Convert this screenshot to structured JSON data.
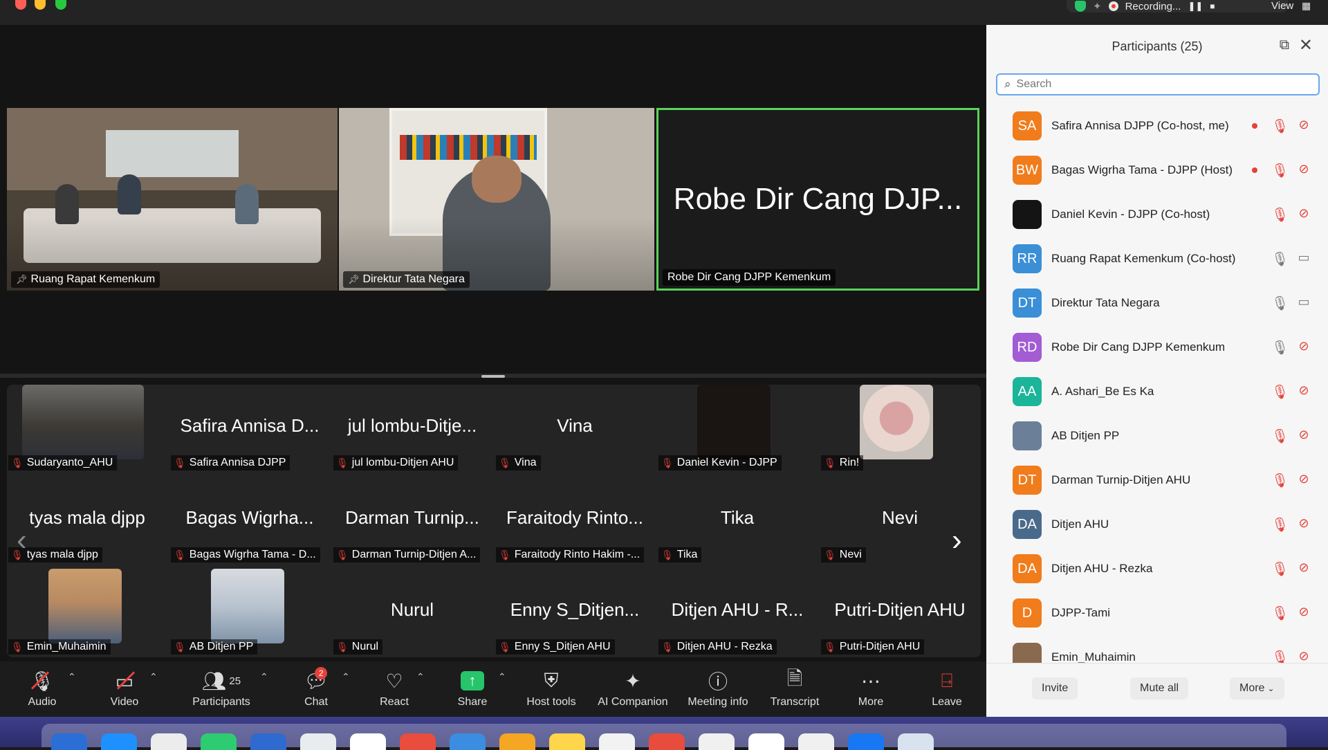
{
  "titlebar": {
    "recording_label": "Recording...",
    "view_label": "View"
  },
  "stage": {
    "top_tiles": [
      {
        "label": "Ruang Rapat Kemenkum"
      },
      {
        "label": "Direktur Tata Negara"
      },
      {
        "big_name": "Robe Dir Cang DJP...",
        "label": "Robe Dir Cang DJPP Kemenkum"
      }
    ]
  },
  "gallery": [
    {
      "big": "",
      "label": "Sudaryanto_AHU"
    },
    {
      "big": "Safira Annisa D...",
      "label": "Safira Annisa DJPP"
    },
    {
      "big": "jul lombu-Ditje...",
      "label": "jul lombu-Ditjen AHU"
    },
    {
      "big": "Vina",
      "label": "Vina"
    },
    {
      "big": "",
      "label": "Daniel Kevin - DJPP"
    },
    {
      "big": "",
      "label": "Rin!"
    },
    {
      "big": "tyas mala djpp",
      "label": "tyas mala djpp"
    },
    {
      "big": "Bagas Wigrha...",
      "label": "Bagas Wigrha Tama - D..."
    },
    {
      "big": "Darman Turnip...",
      "label": "Darman Turnip-Ditjen A..."
    },
    {
      "big": "Faraitody Rinto...",
      "label": "Faraitody Rinto Hakim -..."
    },
    {
      "big": "Tika",
      "label": "Tika"
    },
    {
      "big": "Nevi",
      "label": "Nevi"
    },
    {
      "big": "",
      "label": "Emin_Muhaimin"
    },
    {
      "big": "",
      "label": "AB Ditjen PP"
    },
    {
      "big": "Nurul",
      "label": "Nurul"
    },
    {
      "big": "Enny S_Ditjen...",
      "label": "Enny S_Ditjen AHU"
    },
    {
      "big": "Ditjen AHU - R...",
      "label": "Ditjen AHU - Rezka"
    },
    {
      "big": "Putri-Ditjen AHU",
      "label": "Putri-Ditjen AHU"
    }
  ],
  "toolbar": {
    "audio": "Audio",
    "video": "Video",
    "participants": "Participants",
    "participants_count": "25",
    "chat": "Chat",
    "chat_badge": "2",
    "react": "React",
    "share": "Share",
    "host_tools": "Host tools",
    "ai_companion": "AI Companion",
    "meeting_info": "Meeting info",
    "transcript": "Transcript",
    "more": "More",
    "leave": "Leave"
  },
  "panel": {
    "title": "Participants (25)",
    "search_placeholder": "Search",
    "participants": [
      {
        "initials": "SA",
        "name": "Safira Annisa DJPP (Co-host, me)",
        "color": "#f07c1c",
        "recording": true,
        "mic": "muted",
        "cam": "off"
      },
      {
        "initials": "BW",
        "name": "Bagas Wigrha Tama - DJPP (Host)",
        "color": "#f07c1c",
        "recording": true,
        "mic": "muted",
        "cam": "off"
      },
      {
        "initials": "",
        "name": "Daniel Kevin - DJPP (Co-host)",
        "color": "#141414",
        "recording": false,
        "mic": "muted",
        "cam": "off"
      },
      {
        "initials": "RR",
        "name": "Ruang Rapat Kemenkum (Co-host)",
        "color": "#3a8fd6",
        "recording": false,
        "mic": "on",
        "cam": "on"
      },
      {
        "initials": "DT",
        "name": "Direktur Tata Negara",
        "color": "#3a8fd6",
        "recording": false,
        "mic": "on",
        "cam": "on"
      },
      {
        "initials": "RD",
        "name": "Robe Dir Cang DJPP Kemenkum",
        "color": "#a25cd4",
        "recording": false,
        "mic": "on",
        "cam": "off"
      },
      {
        "initials": "AA",
        "name": "A. Ashari_Be Es Ka",
        "color": "#1bb59a",
        "recording": false,
        "mic": "muted",
        "cam": "off"
      },
      {
        "initials": "",
        "name": "AB Ditjen PP",
        "color": "#6b7f99",
        "recording": false,
        "mic": "muted",
        "cam": "off"
      },
      {
        "initials": "DT",
        "name": "Darman Turnip-Ditjen AHU",
        "color": "#f07c1c",
        "recording": false,
        "mic": "muted",
        "cam": "off"
      },
      {
        "initials": "DA",
        "name": "Ditjen AHU",
        "color": "#4a6a8c",
        "recording": false,
        "mic": "muted",
        "cam": "off"
      },
      {
        "initials": "DA",
        "name": "Ditjen AHU - Rezka",
        "color": "#f07c1c",
        "recording": false,
        "mic": "muted",
        "cam": "off"
      },
      {
        "initials": "D",
        "name": "DJPP-Tami",
        "color": "#f07c1c",
        "recording": false,
        "mic": "muted",
        "cam": "off"
      },
      {
        "initials": "",
        "name": "Emin_Muhaimin",
        "color": "#8a6a4f",
        "recording": false,
        "mic": "muted",
        "cam": "off"
      }
    ],
    "footer": {
      "invite": "Invite",
      "mute_all": "Mute all",
      "more": "More"
    }
  }
}
